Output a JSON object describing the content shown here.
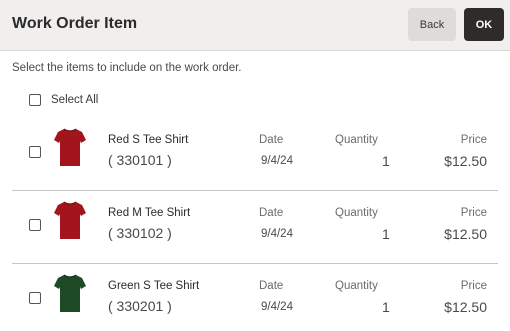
{
  "header": {
    "title": "Work Order Item",
    "back_label": "Back",
    "ok_label": "OK"
  },
  "instructions": "Select the items to include on the work order.",
  "select_all_label": "Select All",
  "columns": {
    "date": "Date",
    "quantity": "Quantity",
    "price": "Price"
  },
  "items": [
    {
      "name": "Red S Tee Shirt",
      "code": "( 330101 )",
      "date": "9/4/24",
      "quantity": "1",
      "price": "$12.50",
      "color": "#a3151c",
      "icon": "red-tee-shirt-icon"
    },
    {
      "name": "Red M Tee Shirt",
      "code": "( 330102 )",
      "date": "9/4/24",
      "quantity": "1",
      "price": "$12.50",
      "color": "#a3151c",
      "icon": "red-tee-shirt-icon"
    },
    {
      "name": "Green S Tee Shirt",
      "code": "( 330201 )",
      "date": "9/4/24",
      "quantity": "1",
      "price": "$12.50",
      "color": "#1e4a25",
      "icon": "green-tee-shirt-icon"
    }
  ]
}
